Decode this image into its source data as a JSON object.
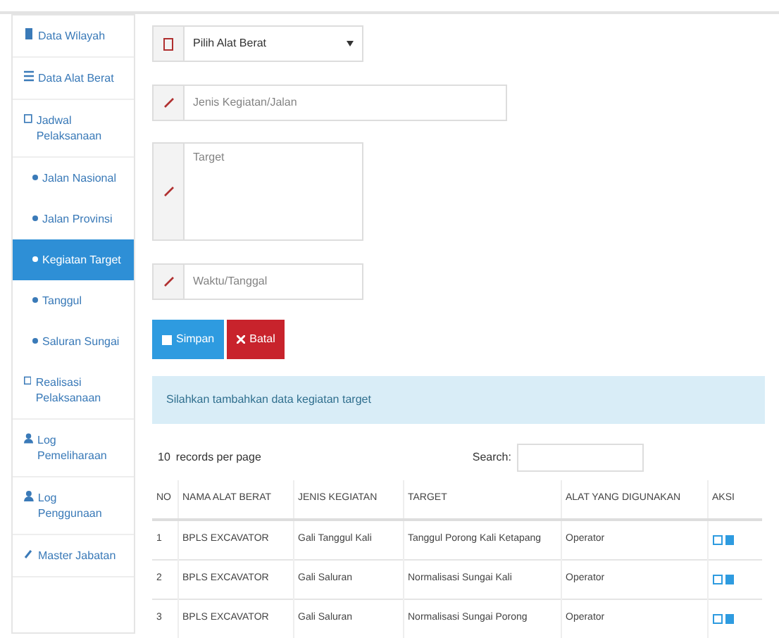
{
  "sidebar": {
    "items": [
      {
        "label": "Data Wilayah",
        "selected": false
      },
      {
        "label": "Data Alat Berat",
        "selected": false
      },
      {
        "label": "Jadwal Pelaksanaan",
        "selected": false,
        "children": [
          {
            "label": "Jalan Nasional",
            "selected": false
          },
          {
            "label": "Jalan Provinsi",
            "selected": false
          },
          {
            "label": "Kegiatan Target",
            "selected": true
          },
          {
            "label": "Tanggul",
            "selected": false
          },
          {
            "label": "Saluran Sungai",
            "selected": false
          }
        ]
      },
      {
        "label": "Realisasi Pelaksanaan",
        "selected": false
      },
      {
        "label": "Log Pemeliharaan",
        "selected": false
      },
      {
        "label": "Log Penggunaan",
        "selected": false
      },
      {
        "label": "Master Jabatan",
        "selected": false
      }
    ]
  },
  "form": {
    "select": {
      "value": "Pilih Alat Berat"
    },
    "activity": {
      "placeholder": "Jenis Kegiatan/Jalan"
    },
    "target": {
      "placeholder": "Target"
    },
    "date": {
      "placeholder": "Waktu/Tanggal"
    },
    "buttons": [
      {
        "label": "Simpan",
        "kind": "primary"
      },
      {
        "label": "Batal",
        "kind": "danger"
      }
    ]
  },
  "alert": "Silahkan tambahkan data kegiatan target",
  "table": {
    "page_size": "10",
    "page_size_label": "records per page",
    "search_label": "Search:",
    "columns": [
      "NO",
      "NAMA ALAT BERAT",
      "JENIS KEGIATAN",
      "TARGET",
      "ALAT YANG DIGUNAKAN",
      "AKSI"
    ],
    "rows": [
      [
        "1",
        "BPLS EXCAVATOR",
        "Gali Tanggul Kali",
        "Tanggul Porong Kali Ketapang",
        "Operator"
      ],
      [
        "2",
        "BPLS EXCAVATOR",
        "Gali Saluran",
        "Normalisasi Sungai Kali",
        "Operator"
      ],
      [
        "3",
        "BPLS EXCAVATOR",
        "Gali Saluran",
        "Normalisasi Sungai Porong",
        "Operator"
      ]
    ]
  }
}
